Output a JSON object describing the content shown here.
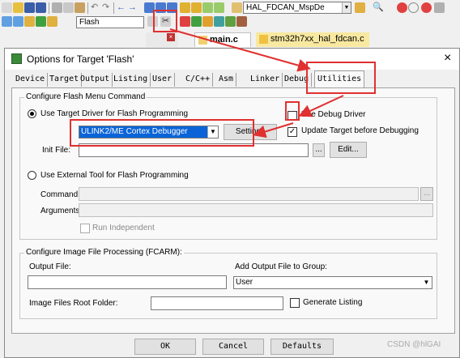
{
  "toolbar": {
    "target_select": "Flash",
    "function_select": "HAL_FDCAN_MspDe",
    "icons": [
      "new-file-icon",
      "open-icon",
      "save-icon",
      "save-all-icon",
      "cut-icon",
      "copy-icon",
      "paste-icon",
      "undo-icon",
      "redo-icon",
      "back-icon",
      "forward-icon",
      "bookmark-icon",
      "find-icon",
      "options-for-target-icon",
      "download-icon",
      "debug-icon",
      "stop-icon"
    ]
  },
  "editor_tabs": [
    {
      "label": "main.c"
    },
    {
      "label": "stm32h7xx_hal_fdcan.c"
    }
  ],
  "dialog": {
    "title": "Options for Target 'Flash'",
    "close": "×",
    "tabs": [
      "Device",
      "Target",
      "Output",
      "Listing",
      "User",
      "C/C++",
      "Asm",
      "Linker",
      "Debug",
      "Utilities"
    ],
    "active_tab": "Utilities",
    "flash_group": {
      "label": "Configure Flash Menu Command",
      "use_target_driver": "Use Target Driver for Flash Programming",
      "driver_value": "ULINK2/ME Cortex Debugger",
      "settings_button": "Settings",
      "use_debug_driver": "Use Debug Driver",
      "update_target": "Update Target before Debugging",
      "update_target_checked": "✓",
      "init_file_label": "Init File:",
      "browse_button": "...",
      "edit_button": "Edit...",
      "use_external_tool": "Use External Tool for Flash Programming",
      "command_label": "Command:",
      "arguments_label": "Arguments:",
      "run_independent": "Run Independent"
    },
    "image_group": {
      "label": "Configure Image File Processing (FCARM):",
      "output_file_label": "Output File:",
      "add_output_label": "Add Output File  to Group:",
      "group_value": "User",
      "root_folder_label": "Image Files Root Folder:",
      "generate_listing": "Generate Listing"
    },
    "buttons": {
      "ok": "OK",
      "cancel": "Cancel",
      "defaults": "Defaults"
    }
  },
  "watermark": "CSDN @hlGAI",
  "colors": {
    "annotation": "#e03030",
    "selection": "#0a64d8"
  }
}
